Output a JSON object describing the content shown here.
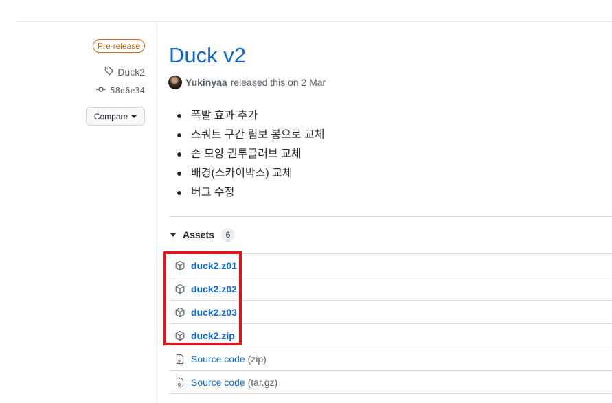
{
  "sidebar": {
    "prerelease_label": "Pre-release",
    "tag": "Duck2",
    "commit": "58d6e34",
    "compare_label": "Compare"
  },
  "release": {
    "title": "Duck v2",
    "author": "Yukinyaa",
    "released_text": "released this on 2 Mar",
    "notes": [
      "폭발 효과 추가",
      "스쿼트 구간 림보 봉으로 교체",
      "손 모양 권투글러브 교체",
      "배경(스카이박스) 교체",
      "버그 수정"
    ]
  },
  "assets": {
    "label": "Assets",
    "count": "6",
    "files": [
      "duck2.z01",
      "duck2.z02",
      "duck2.z03",
      "duck2.zip"
    ],
    "sources": [
      {
        "label": "Source code",
        "ext": "(zip)"
      },
      {
        "label": "Source code",
        "ext": "(tar.gz)"
      }
    ]
  },
  "colors": {
    "link": "#0969da",
    "prerelease": "#d15704",
    "highlight": "#e3131e"
  }
}
